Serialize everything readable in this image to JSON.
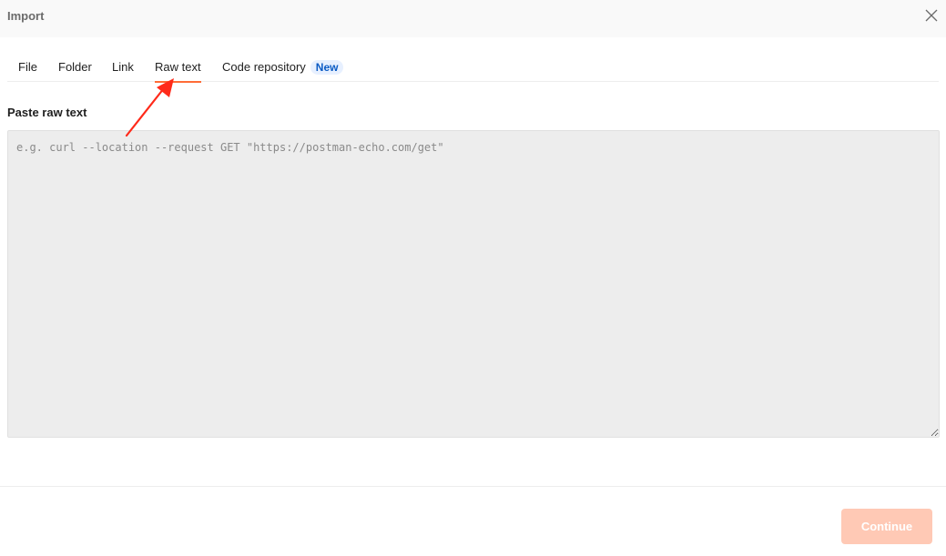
{
  "dialog": {
    "title": "Import",
    "close_icon": "close-icon"
  },
  "tabs": [
    {
      "label": "File",
      "active": false
    },
    {
      "label": "Folder",
      "active": false
    },
    {
      "label": "Link",
      "active": false
    },
    {
      "label": "Raw text",
      "active": true
    },
    {
      "label": "Code repository",
      "active": false,
      "badge": "New"
    }
  ],
  "raw_text": {
    "label": "Paste raw text",
    "value": "",
    "placeholder": "e.g. curl --location --request GET \"https://postman-echo.com/get\""
  },
  "footer": {
    "continue_label": "Continue",
    "continue_disabled": true
  },
  "colors": {
    "accent": "#ff6c37",
    "badge_bg": "#e7f0ff",
    "badge_text": "#0b5bc4",
    "disabled_button": "#ffc9b5",
    "annotation_arrow": "#ff2a1a"
  }
}
